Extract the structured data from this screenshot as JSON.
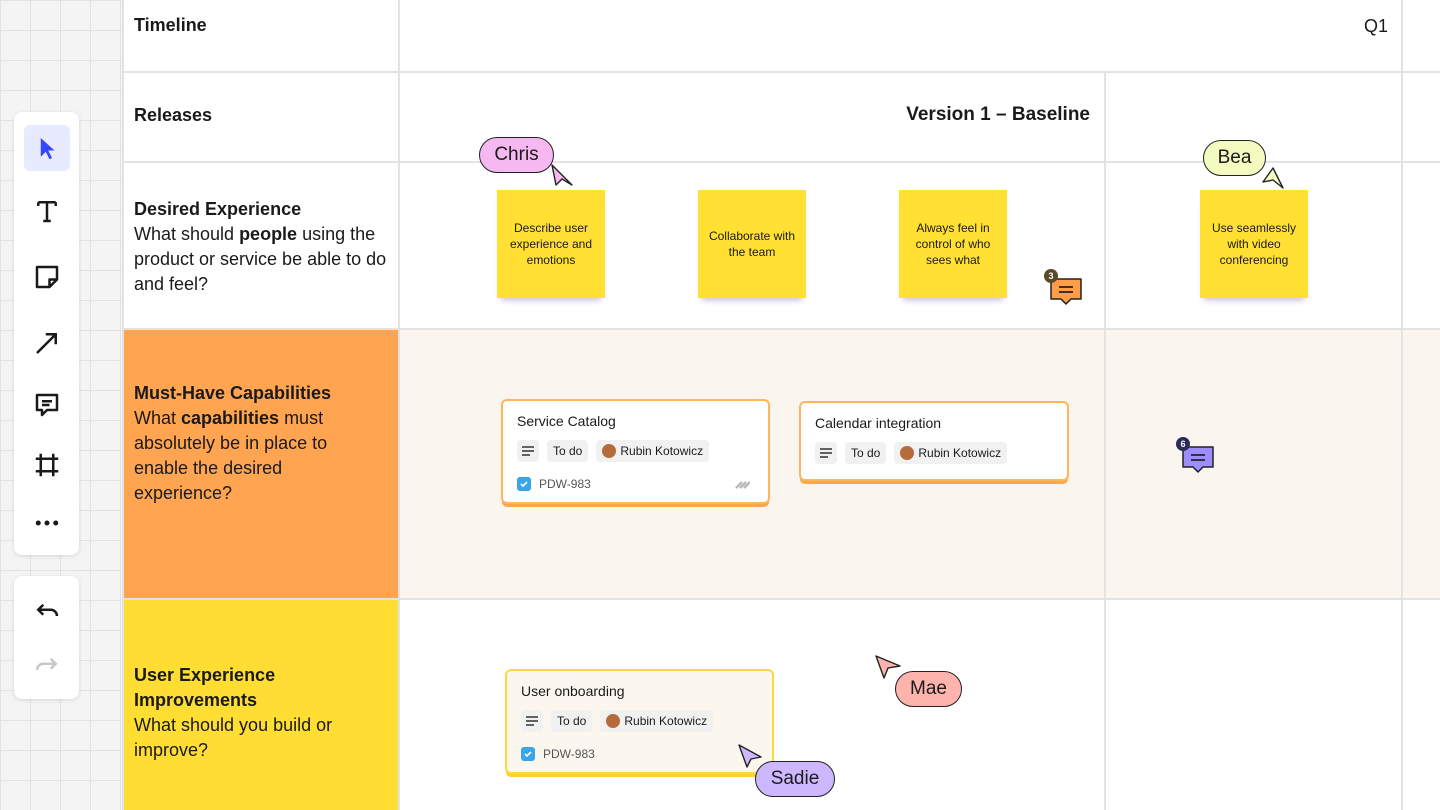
{
  "toolbar": {
    "tools": [
      {
        "icon": "select-cursor-icon"
      },
      {
        "icon": "text-icon"
      },
      {
        "icon": "sticky-note-icon"
      },
      {
        "icon": "arrow-icon"
      },
      {
        "icon": "comment-icon"
      },
      {
        "icon": "frame-icon"
      },
      {
        "icon": "more-icon"
      }
    ],
    "history": [
      {
        "icon": "undo-icon"
      },
      {
        "icon": "redo-icon"
      }
    ]
  },
  "grid": {
    "timeline_label": "Timeline",
    "quarter": "Q1",
    "releases_label": "Releases",
    "release_name": "Version 1 – Baseline"
  },
  "rows": {
    "desired": {
      "title": "Desired Experience",
      "pre": "What should ",
      "bold": "people",
      "post": " using the product or service be able to do and feel?"
    },
    "must": {
      "title": "Must-Have Capabilities",
      "pre": "What ",
      "bold": "capabilities",
      "post": " must absolutely be in place to enable the desired experience?",
      "color": "#ffa552"
    },
    "ux": {
      "title": "User Experience Improvements",
      "body": "What should you build or improve?",
      "color": "#ffdd33"
    }
  },
  "stickies": [
    {
      "text": "Describe  user experience and emotions"
    },
    {
      "text": "Collaborate with the team"
    },
    {
      "text": "Always feel in control of who sees what"
    },
    {
      "text": "Use seamlessly with video conferencing"
    }
  ],
  "cards": [
    {
      "title": "Service Catalog",
      "status": "To do",
      "assignee": "Rubin Kotowicz",
      "ticket": "PDW-983"
    },
    {
      "title": "Calendar integration",
      "status": "To do",
      "assignee": "Rubin Kotowicz"
    },
    {
      "title": "User onboarding",
      "status": "To do",
      "assignee": "Rubin Kotowicz",
      "ticket": "PDW-983"
    }
  ],
  "collaborators": [
    {
      "name": "Chris",
      "color": "#f5b8f0"
    },
    {
      "name": "Bea",
      "color": "#f4fbc0"
    },
    {
      "name": "Mae",
      "color": "#ffb3ad"
    },
    {
      "name": "Sadie",
      "color": "#cdb8ff"
    }
  ],
  "comments": [
    {
      "count": "3",
      "color": "#ff9d48"
    },
    {
      "count": "6",
      "color": "#9d8dff"
    }
  ]
}
